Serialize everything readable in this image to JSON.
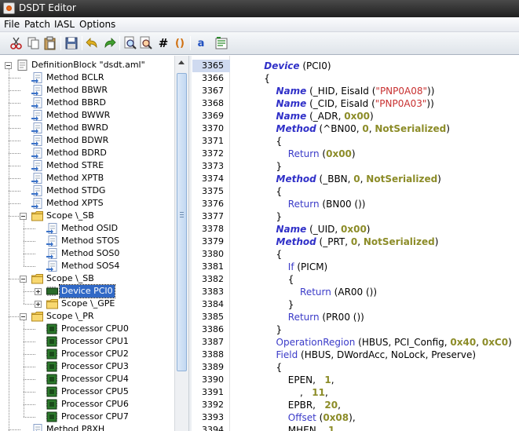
{
  "window": {
    "title": "DSDT Editor"
  },
  "menu": [
    {
      "label": "File"
    },
    {
      "label": "Patch"
    },
    {
      "label": "IASL"
    },
    {
      "label": "Options"
    }
  ],
  "toolbar": [
    {
      "name": "cut-icon"
    },
    {
      "name": "copy-icon"
    },
    {
      "name": "paste-icon"
    },
    {
      "name": "save-icon"
    },
    {
      "name": "undo-icon"
    },
    {
      "name": "redo-icon"
    },
    {
      "name": "find-icon"
    },
    {
      "name": "find-replace-icon"
    },
    {
      "name": "hash-icon",
      "text": "#"
    },
    {
      "name": "braces-icon",
      "text": "()"
    },
    {
      "name": "spellcheck-icon",
      "text": "a"
    },
    {
      "name": "compile-icon"
    }
  ],
  "tree": [
    {
      "label": "DefinitionBlock \"dsdt.aml\"",
      "type": "file"
    },
    {
      "label": "Method BCLR",
      "type": "method"
    },
    {
      "label": "Method BBWR",
      "type": "method"
    },
    {
      "label": "Method BBRD",
      "type": "method"
    },
    {
      "label": "Method BWWR",
      "type": "method"
    },
    {
      "label": "Method BWRD",
      "type": "method"
    },
    {
      "label": "Method BDWR",
      "type": "method"
    },
    {
      "label": "Method BDRD",
      "type": "method"
    },
    {
      "label": "Method STRE",
      "type": "method"
    },
    {
      "label": "Method XPTB",
      "type": "method"
    },
    {
      "label": "Method STDG",
      "type": "method"
    },
    {
      "label": "Method XPTS",
      "type": "method"
    },
    {
      "label": "Scope \\_SB",
      "type": "scope"
    },
    {
      "label": "Method OSID",
      "type": "method"
    },
    {
      "label": "Method STOS",
      "type": "method"
    },
    {
      "label": "Method SOS0",
      "type": "method"
    },
    {
      "label": "Method SOS4",
      "type": "method"
    },
    {
      "label": "Scope \\_SB",
      "type": "scope"
    },
    {
      "label": "Device PCI0",
      "type": "device"
    },
    {
      "label": "Scope \\_GPE",
      "type": "scope"
    },
    {
      "label": "Scope \\_PR",
      "type": "scope"
    },
    {
      "label": "Processor CPU0",
      "type": "processor"
    },
    {
      "label": "Processor CPU1",
      "type": "processor"
    },
    {
      "label": "Processor CPU2",
      "type": "processor"
    },
    {
      "label": "Processor CPU3",
      "type": "processor"
    },
    {
      "label": "Processor CPU4",
      "type": "processor"
    },
    {
      "label": "Processor CPU5",
      "type": "processor"
    },
    {
      "label": "Processor CPU6",
      "type": "processor"
    },
    {
      "label": "Processor CPU7",
      "type": "processor"
    },
    {
      "label": "Method P8XH",
      "type": "method"
    }
  ],
  "code": {
    "current_line": "3365",
    "lines": [
      {
        "n": "3365",
        "parts": [
          [
            "",
            "    "
          ],
          [
            "kw",
            "Device"
          ],
          [
            "",
            " (PCI0)"
          ]
        ]
      },
      {
        "n": "3366",
        "parts": [
          [
            "",
            "    {"
          ]
        ]
      },
      {
        "n": "3367",
        "parts": [
          [
            "",
            "        "
          ],
          [
            "kw",
            "Name"
          ],
          [
            "",
            " (_HID, EisaId ("
          ],
          [
            "str",
            "\"PNP0A08\""
          ],
          [
            "",
            "))"
          ]
        ]
      },
      {
        "n": "3368",
        "parts": [
          [
            "",
            "        "
          ],
          [
            "kw",
            "Name"
          ],
          [
            "",
            " (_CID, EisaId ("
          ],
          [
            "str",
            "\"PNP0A03\""
          ],
          [
            "",
            "))"
          ]
        ]
      },
      {
        "n": "3369",
        "parts": [
          [
            "",
            "        "
          ],
          [
            "kw",
            "Name"
          ],
          [
            "",
            " (_ADR, "
          ],
          [
            "num",
            "0x00"
          ],
          [
            "",
            ")"
          ]
        ]
      },
      {
        "n": "3370",
        "parts": [
          [
            "",
            "        "
          ],
          [
            "kw",
            "Method"
          ],
          [
            "",
            " (^BN00, "
          ],
          [
            "num",
            "0"
          ],
          [
            "",
            ", "
          ],
          [
            "num",
            "NotSerialized"
          ],
          [
            "",
            ")"
          ]
        ]
      },
      {
        "n": "3371",
        "parts": [
          [
            "",
            "        {"
          ]
        ]
      },
      {
        "n": "3372",
        "parts": [
          [
            "",
            "            "
          ],
          [
            "fn",
            "Return"
          ],
          [
            "",
            " ("
          ],
          [
            "num",
            "0x00"
          ],
          [
            "",
            ")"
          ]
        ]
      },
      {
        "n": "3373",
        "parts": [
          [
            "",
            "        }"
          ]
        ]
      },
      {
        "n": "3374",
        "parts": [
          [
            "",
            "        "
          ],
          [
            "kw",
            "Method"
          ],
          [
            "",
            " (_BBN, "
          ],
          [
            "num",
            "0"
          ],
          [
            "",
            ", "
          ],
          [
            "num",
            "NotSerialized"
          ],
          [
            "",
            ")"
          ]
        ]
      },
      {
        "n": "3375",
        "parts": [
          [
            "",
            "        {"
          ]
        ]
      },
      {
        "n": "3376",
        "parts": [
          [
            "",
            "            "
          ],
          [
            "fn",
            "Return"
          ],
          [
            "",
            " (BN00 ())"
          ]
        ]
      },
      {
        "n": "3377",
        "parts": [
          [
            "",
            "        }"
          ]
        ]
      },
      {
        "n": "3378",
        "parts": [
          [
            "",
            "        "
          ],
          [
            "kw",
            "Name"
          ],
          [
            "",
            " (_UID, "
          ],
          [
            "num",
            "0x00"
          ],
          [
            "",
            ")"
          ]
        ]
      },
      {
        "n": "3379",
        "parts": [
          [
            "",
            "        "
          ],
          [
            "kw",
            "Method"
          ],
          [
            "",
            " (_PRT, "
          ],
          [
            "num",
            "0"
          ],
          [
            "",
            ", "
          ],
          [
            "num",
            "NotSerialized"
          ],
          [
            "",
            ")"
          ]
        ]
      },
      {
        "n": "3380",
        "parts": [
          [
            "",
            "        {"
          ]
        ]
      },
      {
        "n": "3381",
        "parts": [
          [
            "",
            "            "
          ],
          [
            "fn",
            "If"
          ],
          [
            "",
            " (PICM)"
          ]
        ]
      },
      {
        "n": "3382",
        "parts": [
          [
            "",
            "            {"
          ]
        ]
      },
      {
        "n": "3383",
        "parts": [
          [
            "",
            "                "
          ],
          [
            "fn",
            "Return"
          ],
          [
            "",
            " (AR00 ())"
          ]
        ]
      },
      {
        "n": "3384",
        "parts": [
          [
            "",
            "            }"
          ]
        ]
      },
      {
        "n": "3385",
        "parts": [
          [
            "",
            "            "
          ],
          [
            "fn",
            "Return"
          ],
          [
            "",
            " (PR00 ())"
          ]
        ]
      },
      {
        "n": "3386",
        "parts": [
          [
            "",
            "        }"
          ]
        ]
      },
      {
        "n": "3387",
        "parts": [
          [
            "",
            "        "
          ],
          [
            "fn",
            "OperationRegion"
          ],
          [
            "",
            " (HBUS, PCI_Config, "
          ],
          [
            "num",
            "0x40"
          ],
          [
            "",
            ", "
          ],
          [
            "num",
            "0xC0"
          ],
          [
            "",
            ")"
          ]
        ]
      },
      {
        "n": "3388",
        "parts": [
          [
            "",
            "        "
          ],
          [
            "fn",
            "Field"
          ],
          [
            "",
            " (HBUS, DWordAcc, NoLock, Preserve)"
          ]
        ]
      },
      {
        "n": "3389",
        "parts": [
          [
            "",
            "        {"
          ]
        ]
      },
      {
        "n": "3390",
        "parts": [
          [
            "",
            "            EPEN,   "
          ],
          [
            "num",
            "1"
          ],
          [
            "",
            ","
          ]
        ]
      },
      {
        "n": "3391",
        "parts": [
          [
            "",
            "                ,   "
          ],
          [
            "num",
            "11"
          ],
          [
            "",
            ","
          ]
        ]
      },
      {
        "n": "3392",
        "parts": [
          [
            "",
            "            EPBR,   "
          ],
          [
            "num",
            "20"
          ],
          [
            "",
            ","
          ]
        ]
      },
      {
        "n": "3393",
        "parts": [
          [
            "",
            "            "
          ],
          [
            "fn",
            "Offset"
          ],
          [
            "",
            " ("
          ],
          [
            "num",
            "0x08"
          ],
          [
            "",
            "),"
          ]
        ]
      },
      {
        "n": "3394",
        "parts": [
          [
            "",
            "            MHEN,   "
          ],
          [
            "num",
            "1"
          ],
          [
            "",
            ","
          ]
        ]
      }
    ]
  }
}
